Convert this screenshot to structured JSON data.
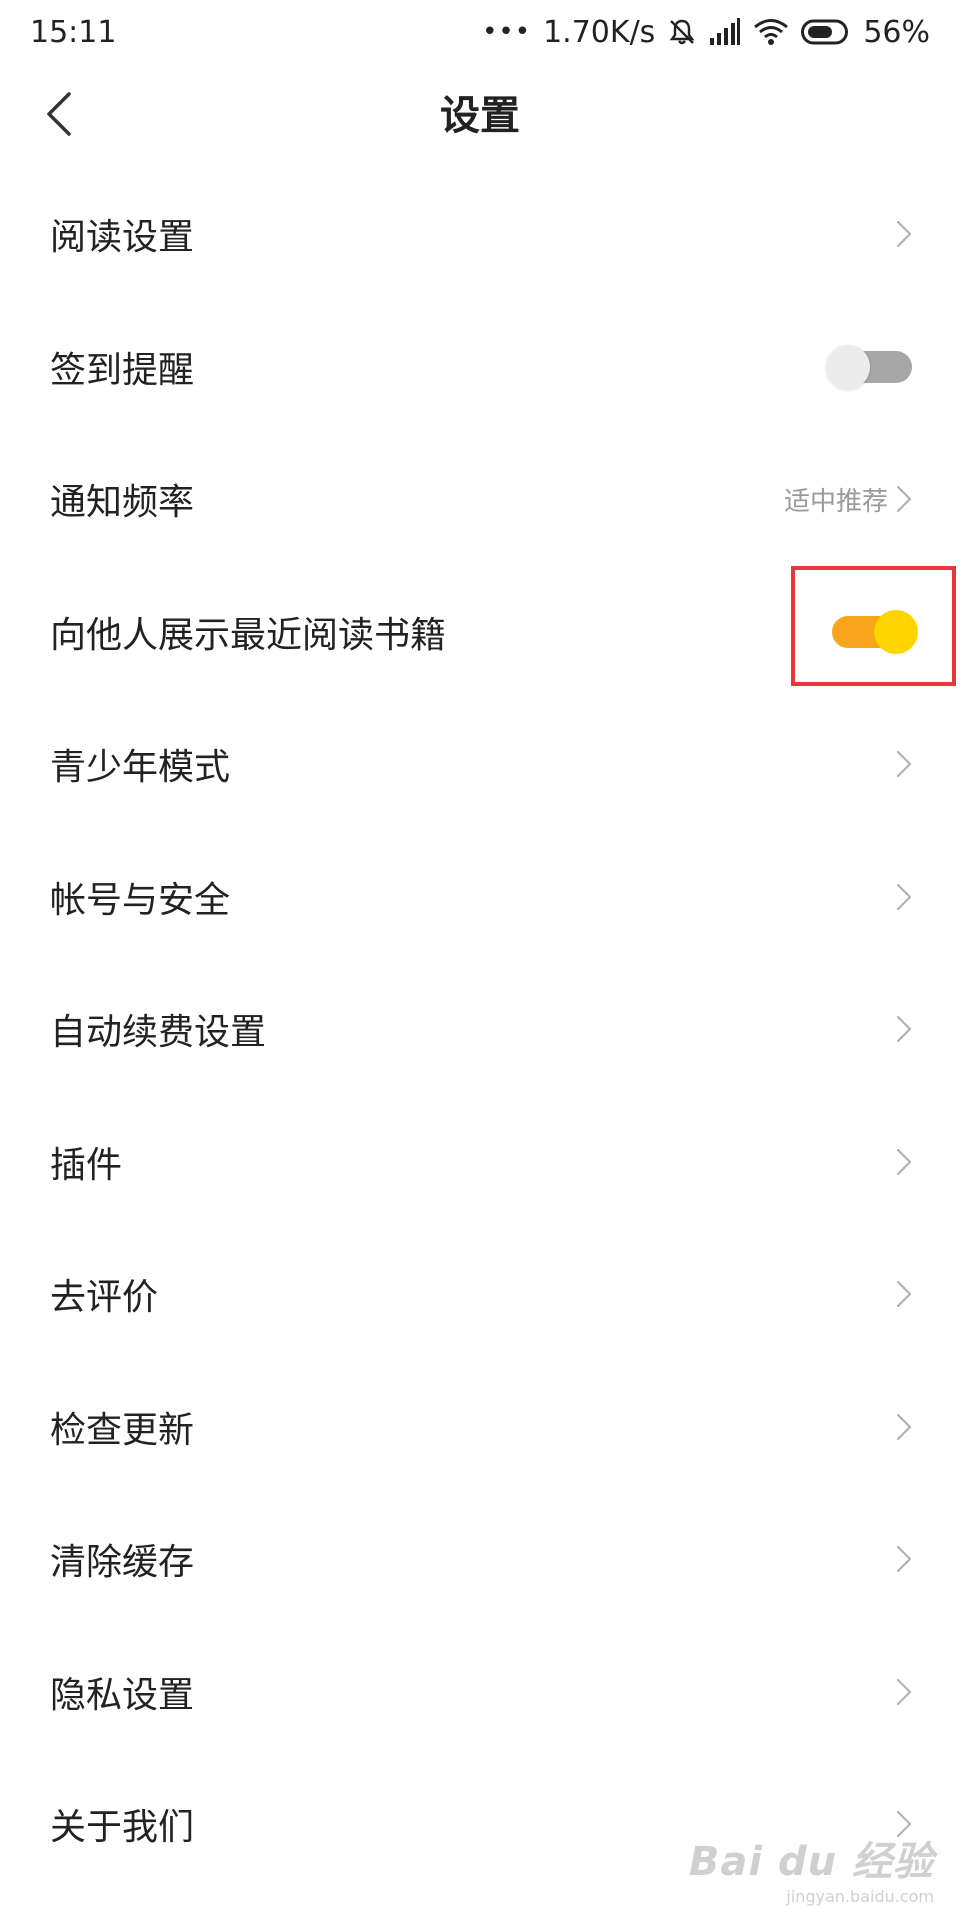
{
  "status_bar": {
    "time": "15:11",
    "dots": "•••",
    "speed": "1.70K/s",
    "battery": "56%",
    "icons": [
      "mute-bell-icon",
      "signal-icon",
      "wifi-icon",
      "battery-icon"
    ]
  },
  "header": {
    "title": "设置",
    "back_icon": "chevron-left-icon"
  },
  "settings": [
    {
      "label": "阅读设置",
      "type": "link"
    },
    {
      "label": "签到提醒",
      "type": "toggle",
      "on": false
    },
    {
      "label": "通知频率",
      "type": "link",
      "value": "适中推荐"
    },
    {
      "label": "向他人展示最近阅读书籍",
      "type": "toggle",
      "on": true
    },
    {
      "label": "青少年模式",
      "type": "link"
    },
    {
      "label": "帐号与安全",
      "type": "link"
    },
    {
      "label": "自动续费设置",
      "type": "link"
    },
    {
      "label": "插件",
      "type": "link"
    },
    {
      "label": "去评价",
      "type": "link"
    },
    {
      "label": "检查更新",
      "type": "link"
    },
    {
      "label": "清除缓存",
      "type": "link"
    },
    {
      "label": "隐私设置",
      "type": "link"
    },
    {
      "label": "关于我们",
      "type": "link"
    }
  ],
  "watermark": {
    "main": "Bai du 经验",
    "sub": "jingyan.baidu.com"
  },
  "colors": {
    "toggle_on_track": "#f7a61b",
    "toggle_on_knob": "#ffd500",
    "toggle_off_track": "#a7a7a7",
    "highlight": "#e8383d"
  }
}
